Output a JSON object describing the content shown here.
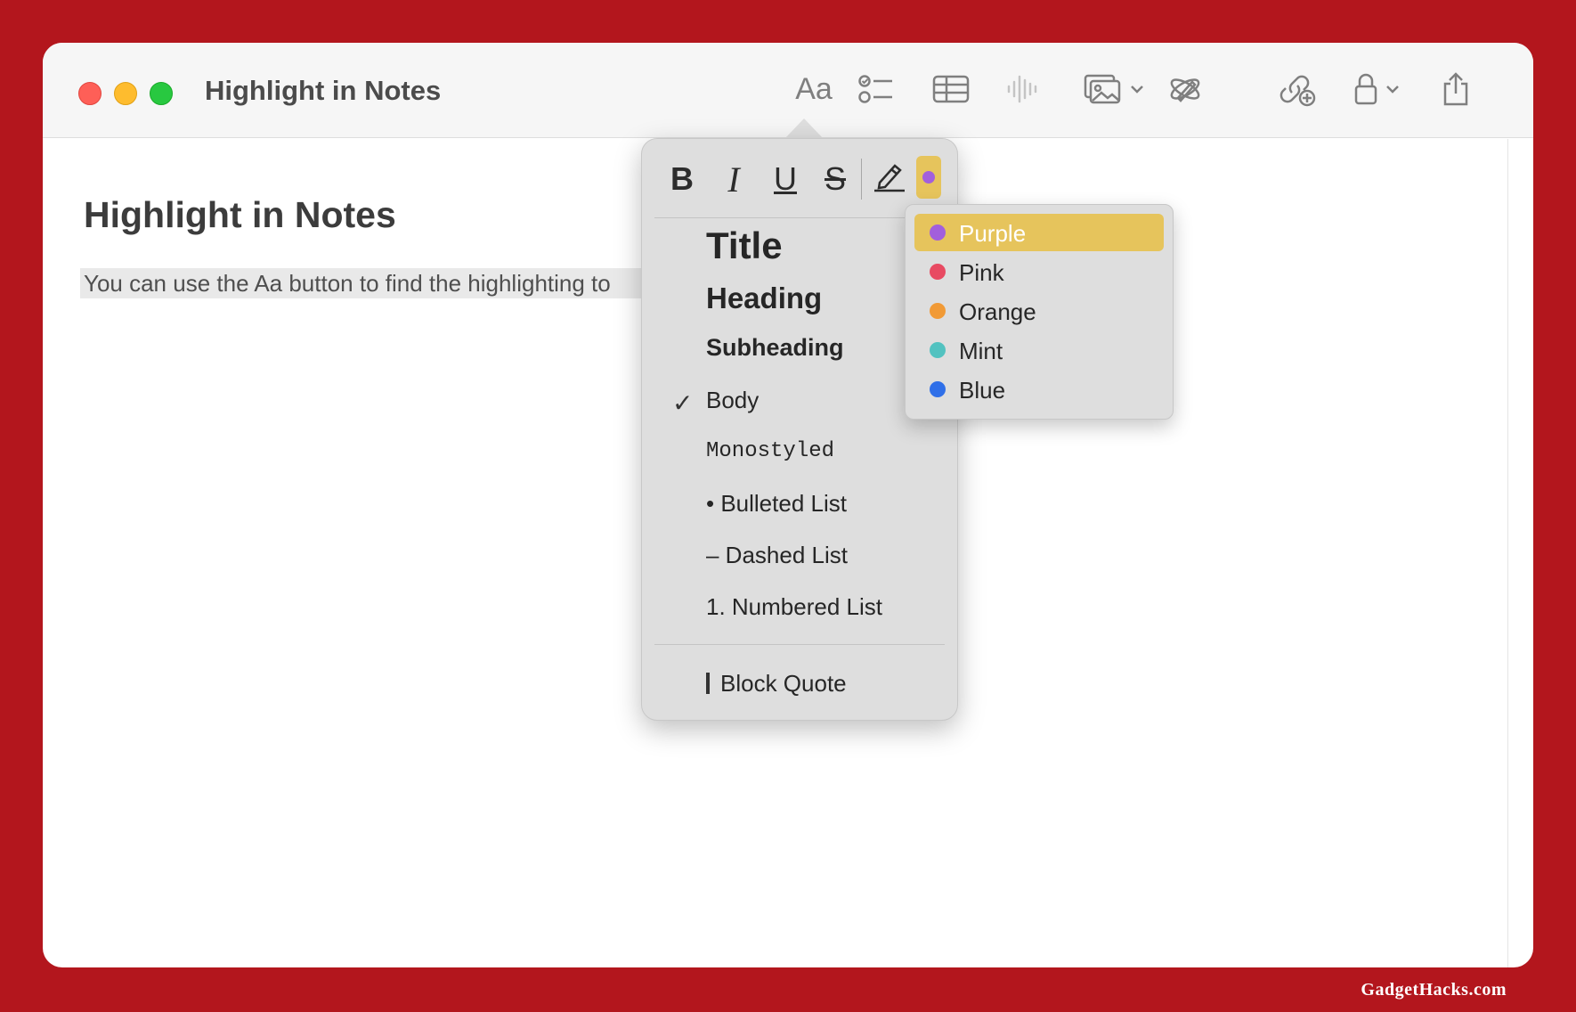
{
  "window": {
    "title": "Highlight in Notes"
  },
  "toolbar": {
    "format_label": "Aa",
    "buttons": [
      "checklist-icon",
      "table-icon",
      "audio-icon",
      "media-icon",
      "writing-tools-icon",
      "collaborate-icon",
      "lock-icon",
      "share-icon"
    ]
  },
  "note": {
    "title": "Highlight in Notes",
    "body": "You can use the Aa button to find the highlighting to"
  },
  "format_popover": {
    "buttons": {
      "bold": "B",
      "italic": "I",
      "underline": "U",
      "strikethrough": "S"
    },
    "styles": [
      {
        "label": "Title"
      },
      {
        "label": "Heading"
      },
      {
        "label": "Subheading"
      },
      {
        "label": "Body",
        "checked": true
      },
      {
        "label": "Monostyled"
      },
      {
        "label": "• Bulleted List"
      },
      {
        "label": "– Dashed List"
      },
      {
        "label": "1. Numbered List"
      },
      {
        "label": "Block Quote"
      }
    ],
    "checkmark": "✓",
    "highlight_color": "#a25fdc"
  },
  "color_menu": {
    "items": [
      {
        "label": "Purple",
        "color": "#a25fdc",
        "selected": true
      },
      {
        "label": "Pink",
        "color": "#e84a62"
      },
      {
        "label": "Orange",
        "color": "#f19a36"
      },
      {
        "label": "Mint",
        "color": "#52c2c0"
      },
      {
        "label": "Blue",
        "color": "#2f6fe8"
      }
    ]
  },
  "watermark": "GadgetHacks.com"
}
